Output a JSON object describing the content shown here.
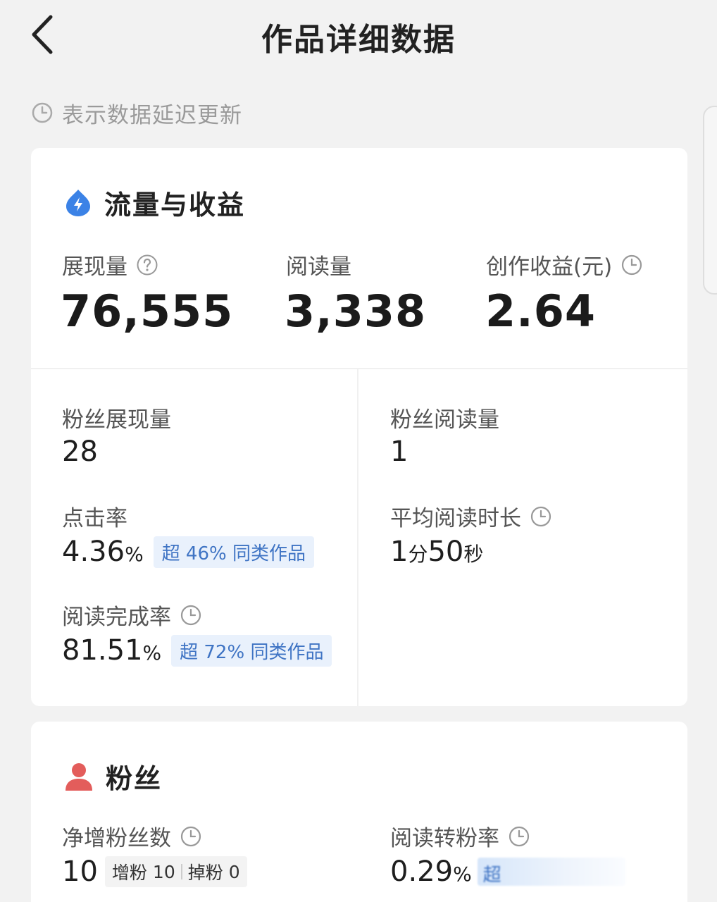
{
  "header": {
    "title": "作品详细数据"
  },
  "notice": {
    "text": "表示数据延迟更新"
  },
  "traffic": {
    "title": "流量与收益",
    "impressions": {
      "label": "展现量",
      "value": "76,555"
    },
    "reads": {
      "label": "阅读量",
      "value": "3,338"
    },
    "earnings": {
      "label": "创作收益(元)",
      "value": "2.64"
    },
    "fan_impressions": {
      "label": "粉丝展现量",
      "value": "28"
    },
    "fan_reads": {
      "label": "粉丝阅读量",
      "value": "1"
    },
    "ctr": {
      "label": "点击率",
      "value": "4.36",
      "unit": "%",
      "badge": "超 46% 同类作品"
    },
    "avg_read_time": {
      "label": "平均阅读时长",
      "min_value": "1",
      "min_unit": "分",
      "sec_value": "50",
      "sec_unit": "秒"
    },
    "completion": {
      "label": "阅读完成率",
      "value": "81.51",
      "unit": "%",
      "badge": "超 72% 同类作品"
    }
  },
  "fans": {
    "title": "粉丝",
    "net_gain": {
      "label": "净增粉丝数",
      "value": "10",
      "gain_label": "增粉",
      "gain_value": "10",
      "loss_label": "掉粉",
      "loss_value": "0"
    },
    "conversion": {
      "label": "阅读转粉率",
      "value": "0.29",
      "unit": "%",
      "badge_partial": "超"
    }
  },
  "colors": {
    "accent_blue": "#3b82e6",
    "fans_red": "#e35d5b",
    "badge_bg": "#e9f1fc",
    "badge_text": "#3f74c4"
  }
}
